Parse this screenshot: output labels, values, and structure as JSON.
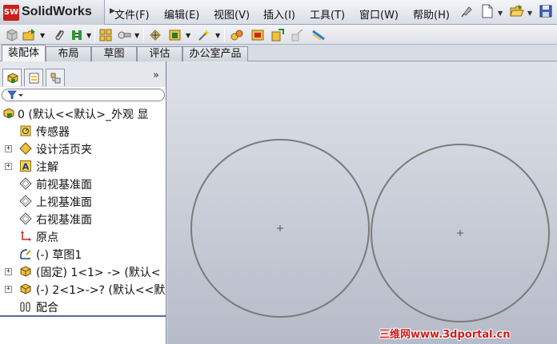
{
  "app": {
    "logo_mark": "SW",
    "name": "SolidWorks"
  },
  "menu": [
    {
      "label": "文件(F)"
    },
    {
      "label": "编辑(E)"
    },
    {
      "label": "视图(V)"
    },
    {
      "label": "插入(I)"
    },
    {
      "label": "工具(T)"
    },
    {
      "label": "窗口(W)"
    },
    {
      "label": "帮助(H)"
    }
  ],
  "menu_right_icons": [
    "pin-icon",
    "new-document-icon",
    "open-folder-icon",
    "save-icon"
  ],
  "toolbar_icons": [
    "rebuild-icon",
    "insert-component-icon",
    "paperclip-icon",
    "mate-icon",
    "component-pattern-icon",
    "smart-fasteners-icon",
    "move-component-icon",
    "hide-show-icon",
    "assembly-features-icon",
    "reference-geometry-icon",
    "new-motion-study-icon",
    "bill-of-materials-icon",
    "exploded-view-icon",
    "explode-line-sketch-icon",
    "interference-detection-icon"
  ],
  "tabs": [
    {
      "label": "装配体",
      "active": true
    },
    {
      "label": "布局",
      "active": false
    },
    {
      "label": "草图",
      "active": false
    },
    {
      "label": "评估",
      "active": false
    },
    {
      "label": "办公室产品",
      "active": false
    }
  ],
  "panel": {
    "tabs": [
      "feature-manager-icon",
      "property-manager-icon",
      "configuration-manager-icon"
    ],
    "collapse_glyph": "»",
    "filter_icon": "filter-icon"
  },
  "tree": [
    {
      "label": "0  (默认<<默认>_外观 显",
      "icon": "assembly-icon",
      "expander": false,
      "indent": 0
    },
    {
      "label": "传感器",
      "icon": "sensor-icon",
      "expander": false,
      "indent": 1
    },
    {
      "label": "设计活页夹",
      "icon": "design-binder-icon",
      "expander": true,
      "indent": 1
    },
    {
      "label": "注解",
      "icon": "annotations-icon",
      "expander": true,
      "indent": 1
    },
    {
      "label": "前视基准面",
      "icon": "plane-icon",
      "expander": false,
      "indent": 1
    },
    {
      "label": "上视基准面",
      "icon": "plane-icon",
      "expander": false,
      "indent": 1
    },
    {
      "label": "右视基准面",
      "icon": "plane-icon",
      "expander": false,
      "indent": 1
    },
    {
      "label": "原点",
      "icon": "origin-icon",
      "expander": false,
      "indent": 1
    },
    {
      "label": "(-) 草图1",
      "icon": "sketch-icon",
      "expander": false,
      "indent": 1
    },
    {
      "label": "(固定) 1<1> -> (默认<",
      "icon": "part-icon",
      "expander": true,
      "indent": 1
    },
    {
      "label": "(-) 2<1>->? (默认<<默",
      "icon": "part-icon",
      "expander": true,
      "indent": 1
    },
    {
      "label": "配合",
      "icon": "mates-icon",
      "expander": false,
      "indent": 1
    }
  ],
  "viewport": {
    "background": "#c4c8d2",
    "sketch_color": "#7a7a7a",
    "circles": [
      {
        "name": "left-circle"
      },
      {
        "name": "right-circle"
      }
    ]
  },
  "watermark": "三维网www.3dportal.cn",
  "colors": {
    "accent": "#c8201c",
    "watermark": "#d21a1a"
  }
}
